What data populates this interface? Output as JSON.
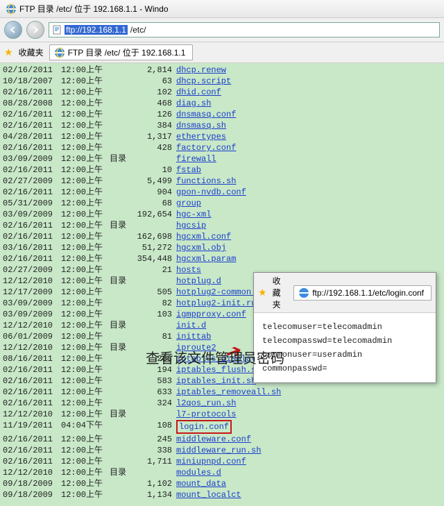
{
  "window": {
    "title": "FTP 目录 /etc/ 位于 192.168.1.1 - Windo"
  },
  "address": {
    "protocol_host": "ftp://192.168.1.1",
    "path": "/etc/"
  },
  "favorites": {
    "label": "收藏夹"
  },
  "tab": {
    "title": "FTP 目录 /etc/ 位于 192.168.1.1"
  },
  "popup": {
    "favorites_label": "收藏夹",
    "address": "ftp://192.168.1.1/etc/login.conf",
    "lines": [
      "telecomuser=telecomadmin",
      "telecompasswd=telecomadmin",
      "commonuser=useradmin",
      "commonpasswd="
    ]
  },
  "caption": "查看该文件管理员密码",
  "dir_label": "目录",
  "listing": [
    {
      "date": "02/16/2011",
      "time": "12:00上午",
      "size": "2,814",
      "name": "dhcp.renew"
    },
    {
      "date": "10/18/2007",
      "time": "12:00上午",
      "size": "63",
      "name": "dhcp.script"
    },
    {
      "date": "02/16/2011",
      "time": "12:00上午",
      "size": "102",
      "name": "dhid.conf"
    },
    {
      "date": "08/28/2008",
      "time": "12:00上午",
      "size": "468",
      "name": "diag.sh"
    },
    {
      "date": "02/16/2011",
      "time": "12:00上午",
      "size": "126",
      "name": "dnsmasq.conf"
    },
    {
      "date": "02/16/2011",
      "time": "12:00上午",
      "size": "384",
      "name": "dnsmasq.sh"
    },
    {
      "date": "04/28/2011",
      "time": "12:00上午",
      "size": "1,317",
      "name": "ethertypes"
    },
    {
      "date": "02/16/2011",
      "time": "12:00上午",
      "size": "428",
      "name": "factory.conf"
    },
    {
      "date": "03/09/2009",
      "time": "12:00上午",
      "kind": "目录",
      "name": "firewall",
      "dir": true
    },
    {
      "date": "02/16/2011",
      "time": "12:00上午",
      "size": "10",
      "name": "fstab"
    },
    {
      "date": "02/27/2009",
      "time": "12:00上午",
      "size": "5,499",
      "name": "functions.sh"
    },
    {
      "date": "02/16/2011",
      "time": "12:00上午",
      "size": "904",
      "name": "gpon-nvdb.conf"
    },
    {
      "date": "05/31/2009",
      "time": "12:00上午",
      "size": "68",
      "name": "group"
    },
    {
      "date": "03/09/2009",
      "time": "12:00上午",
      "size": "192,654",
      "name": "hgc-xml"
    },
    {
      "date": "02/16/2011",
      "time": "12:00上午",
      "kind": "目录",
      "name": "hgcsip",
      "dir": true
    },
    {
      "date": "02/16/2011",
      "time": "12:00上午",
      "size": "162,698",
      "name": "hgcxml.conf"
    },
    {
      "date": "03/16/2011",
      "time": "12:00上午",
      "size": "51,272",
      "name": "hgcxml.obj"
    },
    {
      "date": "02/16/2011",
      "time": "12:00上午",
      "size": "354,448",
      "name": "hgcxml.param"
    },
    {
      "date": "02/27/2009",
      "time": "12:00上午",
      "size": "21",
      "name": "hosts"
    },
    {
      "date": "12/12/2010",
      "time": "12:00上午",
      "kind": "目录",
      "name": "hotplug.d",
      "dir": true
    },
    {
      "date": "12/17/2009",
      "time": "12:00上午",
      "size": "505",
      "name": "hotplug2-common.rules"
    },
    {
      "date": "03/09/2009",
      "time": "12:00上午",
      "size": "82",
      "name": "hotplug2-init.rules"
    },
    {
      "date": "03/09/2009",
      "time": "12:00上午",
      "size": "103",
      "name": "igmpproxy.conf"
    },
    {
      "date": "12/12/2010",
      "time": "12:00上午",
      "kind": "目录",
      "name": "init.d",
      "dir": true
    },
    {
      "date": "06/01/2009",
      "time": "12:00上午",
      "size": "81",
      "name": "inittab"
    },
    {
      "date": "12/12/2010",
      "time": "12:00上午",
      "kind": "目录",
      "name": "iproute2",
      "dir": true
    },
    {
      "date": "08/16/2011",
      "time": "12:00上午",
      "size": "288",
      "name": "iptables_display.sh"
    },
    {
      "date": "02/16/2011",
      "time": "12:00上午",
      "size": "194",
      "name": "iptables_flush.sh"
    },
    {
      "date": "02/16/2011",
      "time": "12:00上午",
      "size": "583",
      "name": "iptables_init.sh"
    },
    {
      "date": "02/16/2011",
      "time": "12:00上午",
      "size": "633",
      "name": "iptables_removeall.sh"
    },
    {
      "date": "02/16/2011",
      "time": "12:00上午",
      "size": "324",
      "name": "l2qos_run.sh"
    },
    {
      "date": "12/12/2010",
      "time": "12:00上午",
      "kind": "目录",
      "name": "l7-protocols",
      "dir": true
    },
    {
      "date": "11/19/2011",
      "time": "04:04下午",
      "size": "108",
      "name": "login.conf",
      "highlight": true
    },
    {
      "date": "02/16/2011",
      "time": "12:00上午",
      "size": "245",
      "name": "middleware.conf"
    },
    {
      "date": "02/16/2011",
      "time": "12:00上午",
      "size": "338",
      "name": "middleware_run.sh"
    },
    {
      "date": "02/16/2011",
      "time": "12:00上午",
      "size": "1,711",
      "name": "miniupnpd.conf"
    },
    {
      "date": "12/12/2010",
      "time": "12:00上午",
      "kind": "目录",
      "name": "modules.d",
      "dir": true
    },
    {
      "date": "09/18/2009",
      "time": "12:00上午",
      "size": "1,102",
      "name": "mount_data"
    },
    {
      "date": "09/18/2009",
      "time": "12:00上午",
      "size": "1,134",
      "name": "mount_localct"
    }
  ]
}
